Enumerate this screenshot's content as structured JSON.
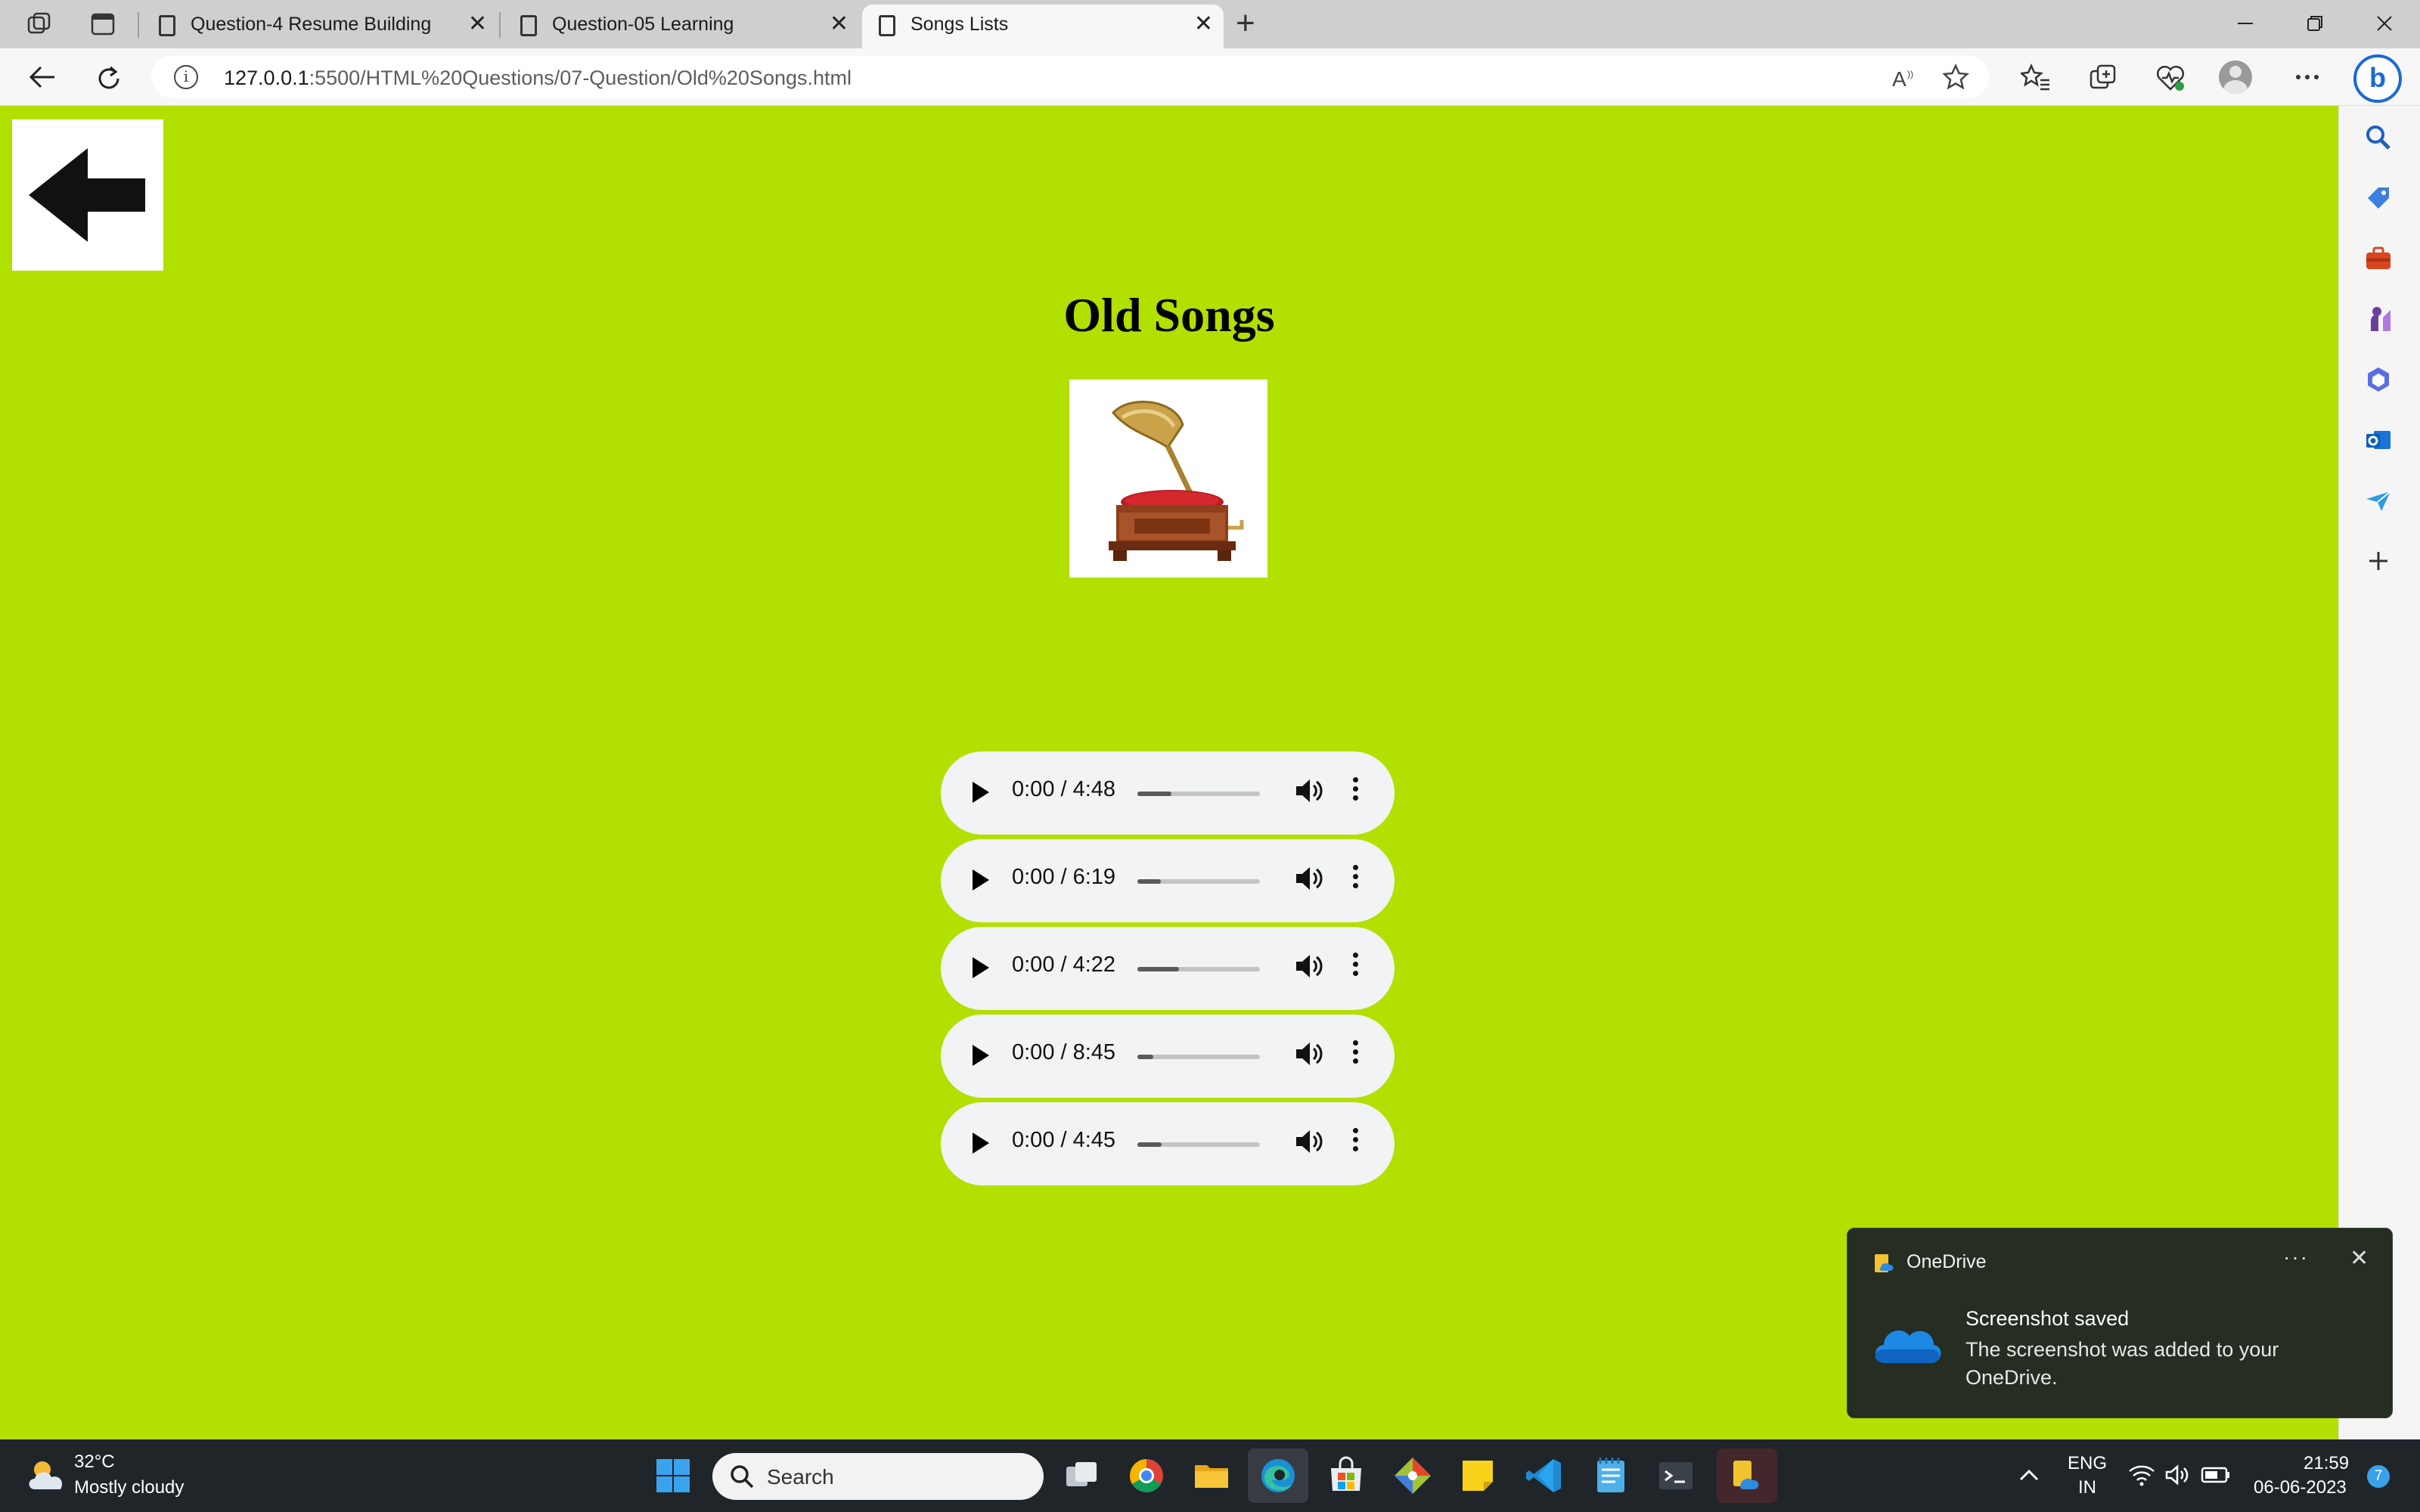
{
  "browser": {
    "tabs": [
      {
        "title": "Question-4 Resume Building"
      },
      {
        "title": "Question-05 Learning"
      },
      {
        "title": "Songs Lists"
      }
    ],
    "tab_close_glyph": "✕",
    "new_tab_glyph": "+",
    "url_host": "127.0.0.1",
    "url_rest": ":5500/HTML%20Questions/07-Question/Old%20Songs.html",
    "colors": {
      "page_background": "#b2e000",
      "toolbar": "#f7f7f7",
      "tabbar": "#cfcfcf"
    }
  },
  "page": {
    "title": "Old Songs",
    "back_button_icon": "left-arrow-icon",
    "image_icon": "gramophone-image",
    "players": [
      {
        "time": "0:00 / 4:48",
        "buffered_fraction": 0.28
      },
      {
        "time": "0:00 / 6:19",
        "buffered_fraction": 0.19
      },
      {
        "time": "0:00 / 4:22",
        "buffered_fraction": 0.34
      },
      {
        "time": "0:00 / 8:45",
        "buffered_fraction": 0.13
      },
      {
        "time": "0:00 / 4:45",
        "buffered_fraction": 0.2
      }
    ]
  },
  "toast": {
    "app_name": "OneDrive",
    "more_glyph": "···",
    "close_glyph": "✕",
    "heading": "Screenshot saved",
    "message": "The screenshot was added to your OneDrive."
  },
  "taskbar": {
    "weather_temp": "32°C",
    "weather_desc": "Mostly cloudy",
    "search_label": "Search",
    "lang_top": "ENG",
    "lang_bottom": "IN",
    "clock_time": "21:59",
    "clock_date": "06-06-2023",
    "notification_count": "7"
  }
}
